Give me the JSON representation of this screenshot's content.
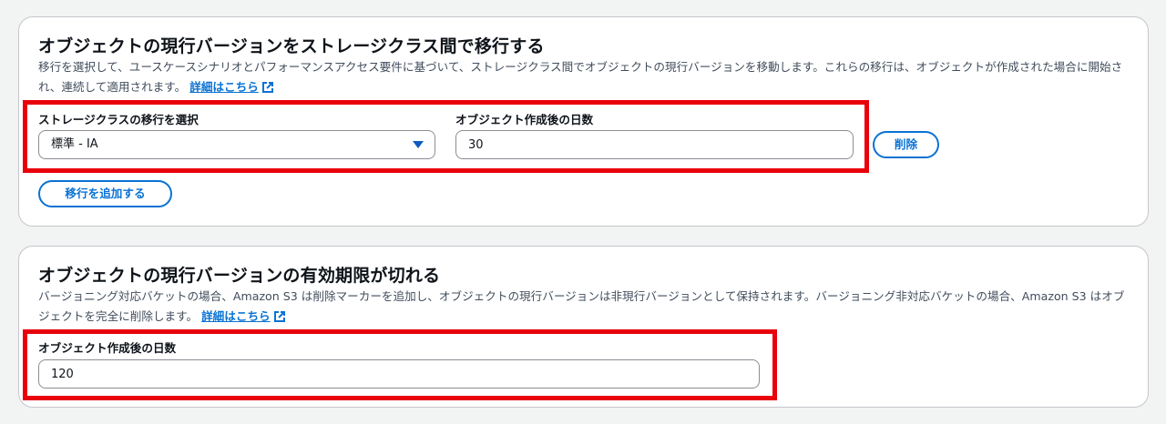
{
  "transitions_section": {
    "title": "オブジェクトの現行バージョンをストレージクラス間で移行する",
    "description": "移行を選択して、ユースケースシナリオとパフォーマンスアクセス要件に基づいて、ストレージクラス間でオブジェクトの現行バージョンを移動します。これらの移行は、オブジェクトが作成された場合に開始され、連続して適用されます。",
    "learn_more_link": "詳細はこちら",
    "storage_class_label": "ストレージクラスの移行を選択",
    "storage_class_value": "標準 - IA",
    "days_label": "オブジェクト作成後の日数",
    "days_value": "30",
    "remove_button": "削除",
    "add_transition_button": "移行を追加する"
  },
  "expiration_section": {
    "title": "オブジェクトの現行バージョンの有効期限が切れる",
    "description": "バージョニング対応バケットの場合、Amazon S3 は削除マーカーを追加し、オブジェクトの現行バージョンは非現行バージョンとして保持されます。バージョニング非対応バケットの場合、Amazon S3 はオブジェクトを完全に削除します。",
    "learn_more_link": "詳細はこちら",
    "days_label": "オブジェクト作成後の日数",
    "days_value": "120"
  },
  "colors": {
    "link": "#0972d3",
    "highlight": "#e8000b",
    "border": "#c6c6cd"
  },
  "icons": [
    "caret-down-icon",
    "external-link-icon"
  ]
}
